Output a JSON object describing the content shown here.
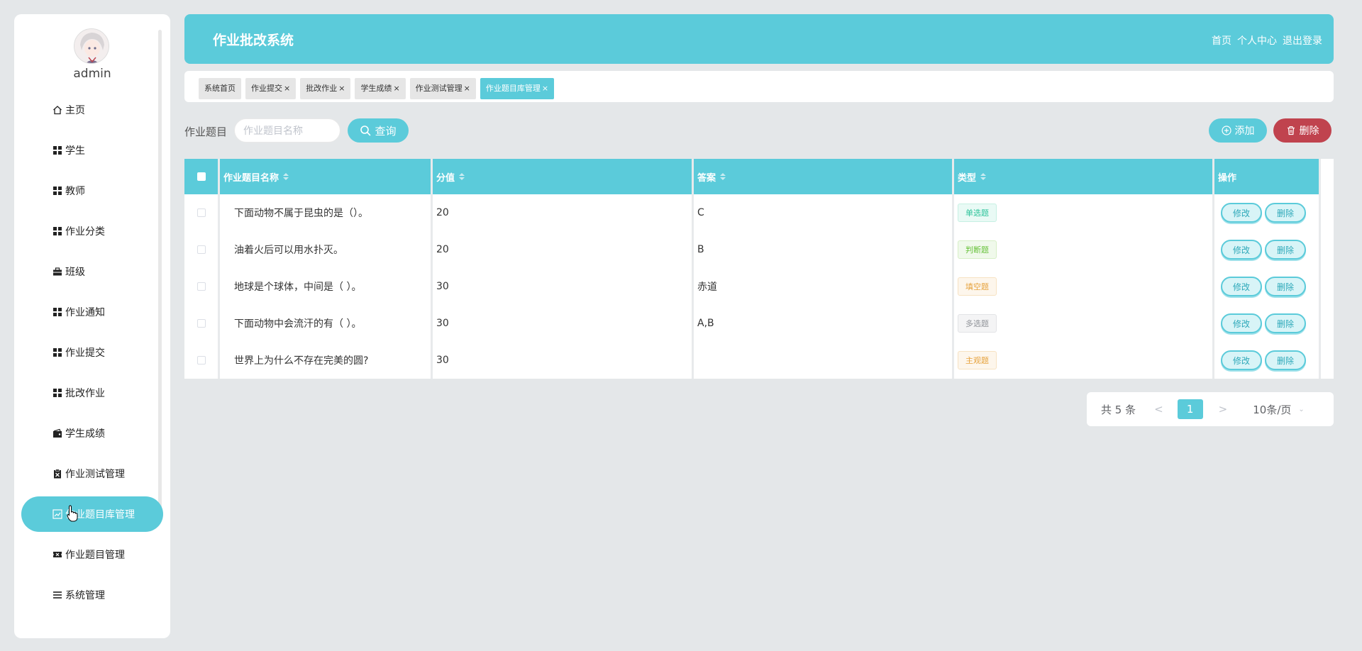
{
  "sidebar": {
    "username": "admin",
    "items": [
      {
        "label": "主页",
        "icon": "home-icon"
      },
      {
        "label": "学生",
        "icon": "grid-icon"
      },
      {
        "label": "教师",
        "icon": "grid-icon"
      },
      {
        "label": "作业分类",
        "icon": "grid-icon"
      },
      {
        "label": "班级",
        "icon": "briefcase-icon"
      },
      {
        "label": "作业通知",
        "icon": "grid-icon"
      },
      {
        "label": "作业提交",
        "icon": "grid-icon"
      },
      {
        "label": "批改作业",
        "icon": "grid-icon"
      },
      {
        "label": "学生成绩",
        "icon": "wallet-icon"
      },
      {
        "label": "作业测试管理",
        "icon": "clipboard-icon"
      },
      {
        "label": "作业题目库管理",
        "icon": "chart-icon"
      },
      {
        "label": "作业题目管理",
        "icon": "ticket-icon"
      },
      {
        "label": "系统管理",
        "icon": "list-icon"
      }
    ],
    "active_index": 10
  },
  "header": {
    "title": "作业批改系统",
    "links": [
      "首页",
      "个人中心",
      "退出登录"
    ]
  },
  "tabs": [
    {
      "label": "系统首页",
      "closable": false
    },
    {
      "label": "作业提交",
      "closable": true
    },
    {
      "label": "批改作业",
      "closable": true
    },
    {
      "label": "学生成绩",
      "closable": true
    },
    {
      "label": "作业测试管理",
      "closable": true
    },
    {
      "label": "作业题目库管理",
      "closable": true,
      "active": true
    }
  ],
  "search": {
    "label": "作业题目",
    "placeholder": "作业题目名称",
    "value": "",
    "query_label": "查询"
  },
  "actions": {
    "add_label": "添加",
    "delete_label": "删除"
  },
  "table": {
    "headers": [
      "作业题目名称",
      "分值",
      "答案",
      "类型",
      "操作"
    ],
    "rows": [
      {
        "name": "下面动物不属于昆虫的是（）。",
        "score": "20",
        "answer": "C",
        "type": "单选题"
      },
      {
        "name": "油着火后可以用水扑灭。",
        "score": "20",
        "answer": "B",
        "type": "判断题"
      },
      {
        "name": "地球是个球体，中间是（ ）。",
        "score": "30",
        "answer": "赤道",
        "type": "填空题"
      },
      {
        "name": "下面动物中会流汗的有（ ）。",
        "score": "30",
        "answer": "A,B",
        "type": "多选题"
      },
      {
        "name": "世界上为什么不存在完美的圆?",
        "score": "30",
        "answer": "",
        "type": "主观题"
      }
    ],
    "edit_label": "修改",
    "row_delete_label": "删除"
  },
  "type_colors": {
    "单选题": {
      "text": "#2cc39a",
      "bg": "#e9faf5",
      "border": "#c6f0e3"
    },
    "判断题": {
      "text": "#67c23a",
      "bg": "#f0f9eb",
      "border": "#d6efc6"
    },
    "填空题": {
      "text": "#e6a23c",
      "bg": "#fdf6ec",
      "border": "#f7e2c2"
    },
    "多选题": {
      "text": "#909399",
      "bg": "#f4f4f5",
      "border": "#e2e3e6"
    },
    "主观题": {
      "text": "#e6a23c",
      "bg": "#fdf6ec",
      "border": "#f7e2c2"
    }
  },
  "pagination": {
    "total_label": "共 5 条",
    "current_page": "1",
    "page_size_label": "10条/页"
  },
  "colors": {
    "accent": "#5bcbda",
    "danger": "#c0434e",
    "background": "#e4e7e9"
  }
}
